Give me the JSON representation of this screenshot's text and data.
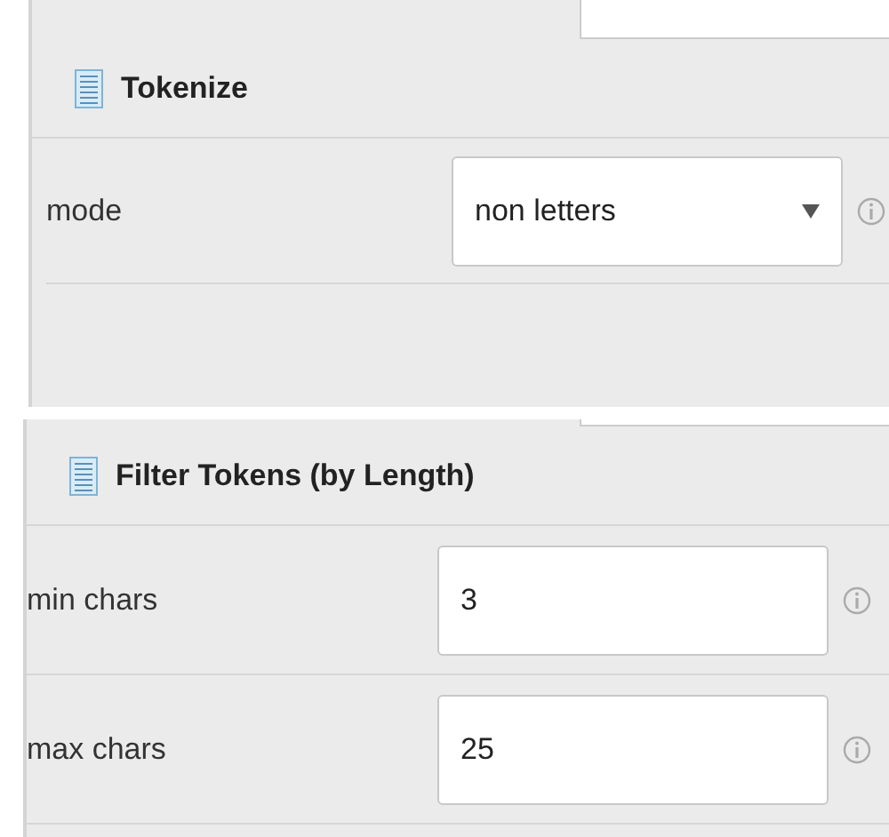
{
  "panels": [
    {
      "title": "Tokenize",
      "params": [
        {
          "kind": "select",
          "label": "mode",
          "value": "non letters"
        }
      ]
    },
    {
      "title": "Filter Tokens (by Length)",
      "params": [
        {
          "kind": "text",
          "label": "min chars",
          "value": "3"
        },
        {
          "kind": "text",
          "label": "max chars",
          "value": "25"
        }
      ]
    }
  ]
}
